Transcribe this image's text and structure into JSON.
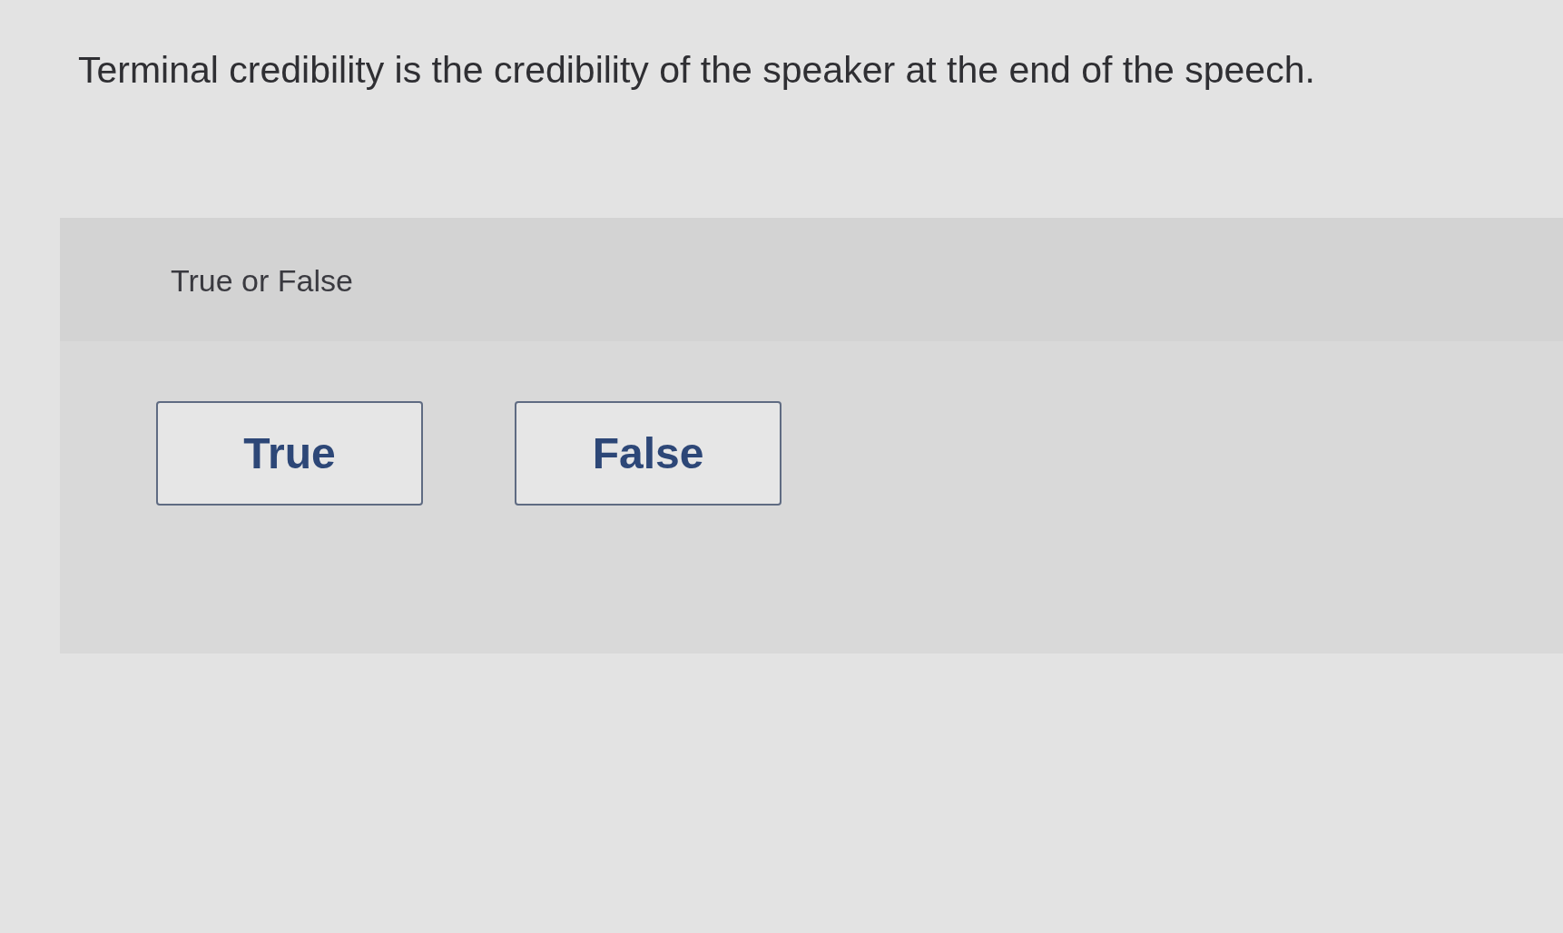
{
  "question": {
    "text": "Terminal credibility is the credibility of the speaker at the end of the speech."
  },
  "answer_panel": {
    "prompt": "True or False",
    "options": [
      {
        "label": "True",
        "selected": false
      },
      {
        "label": "False",
        "selected": false
      }
    ]
  }
}
